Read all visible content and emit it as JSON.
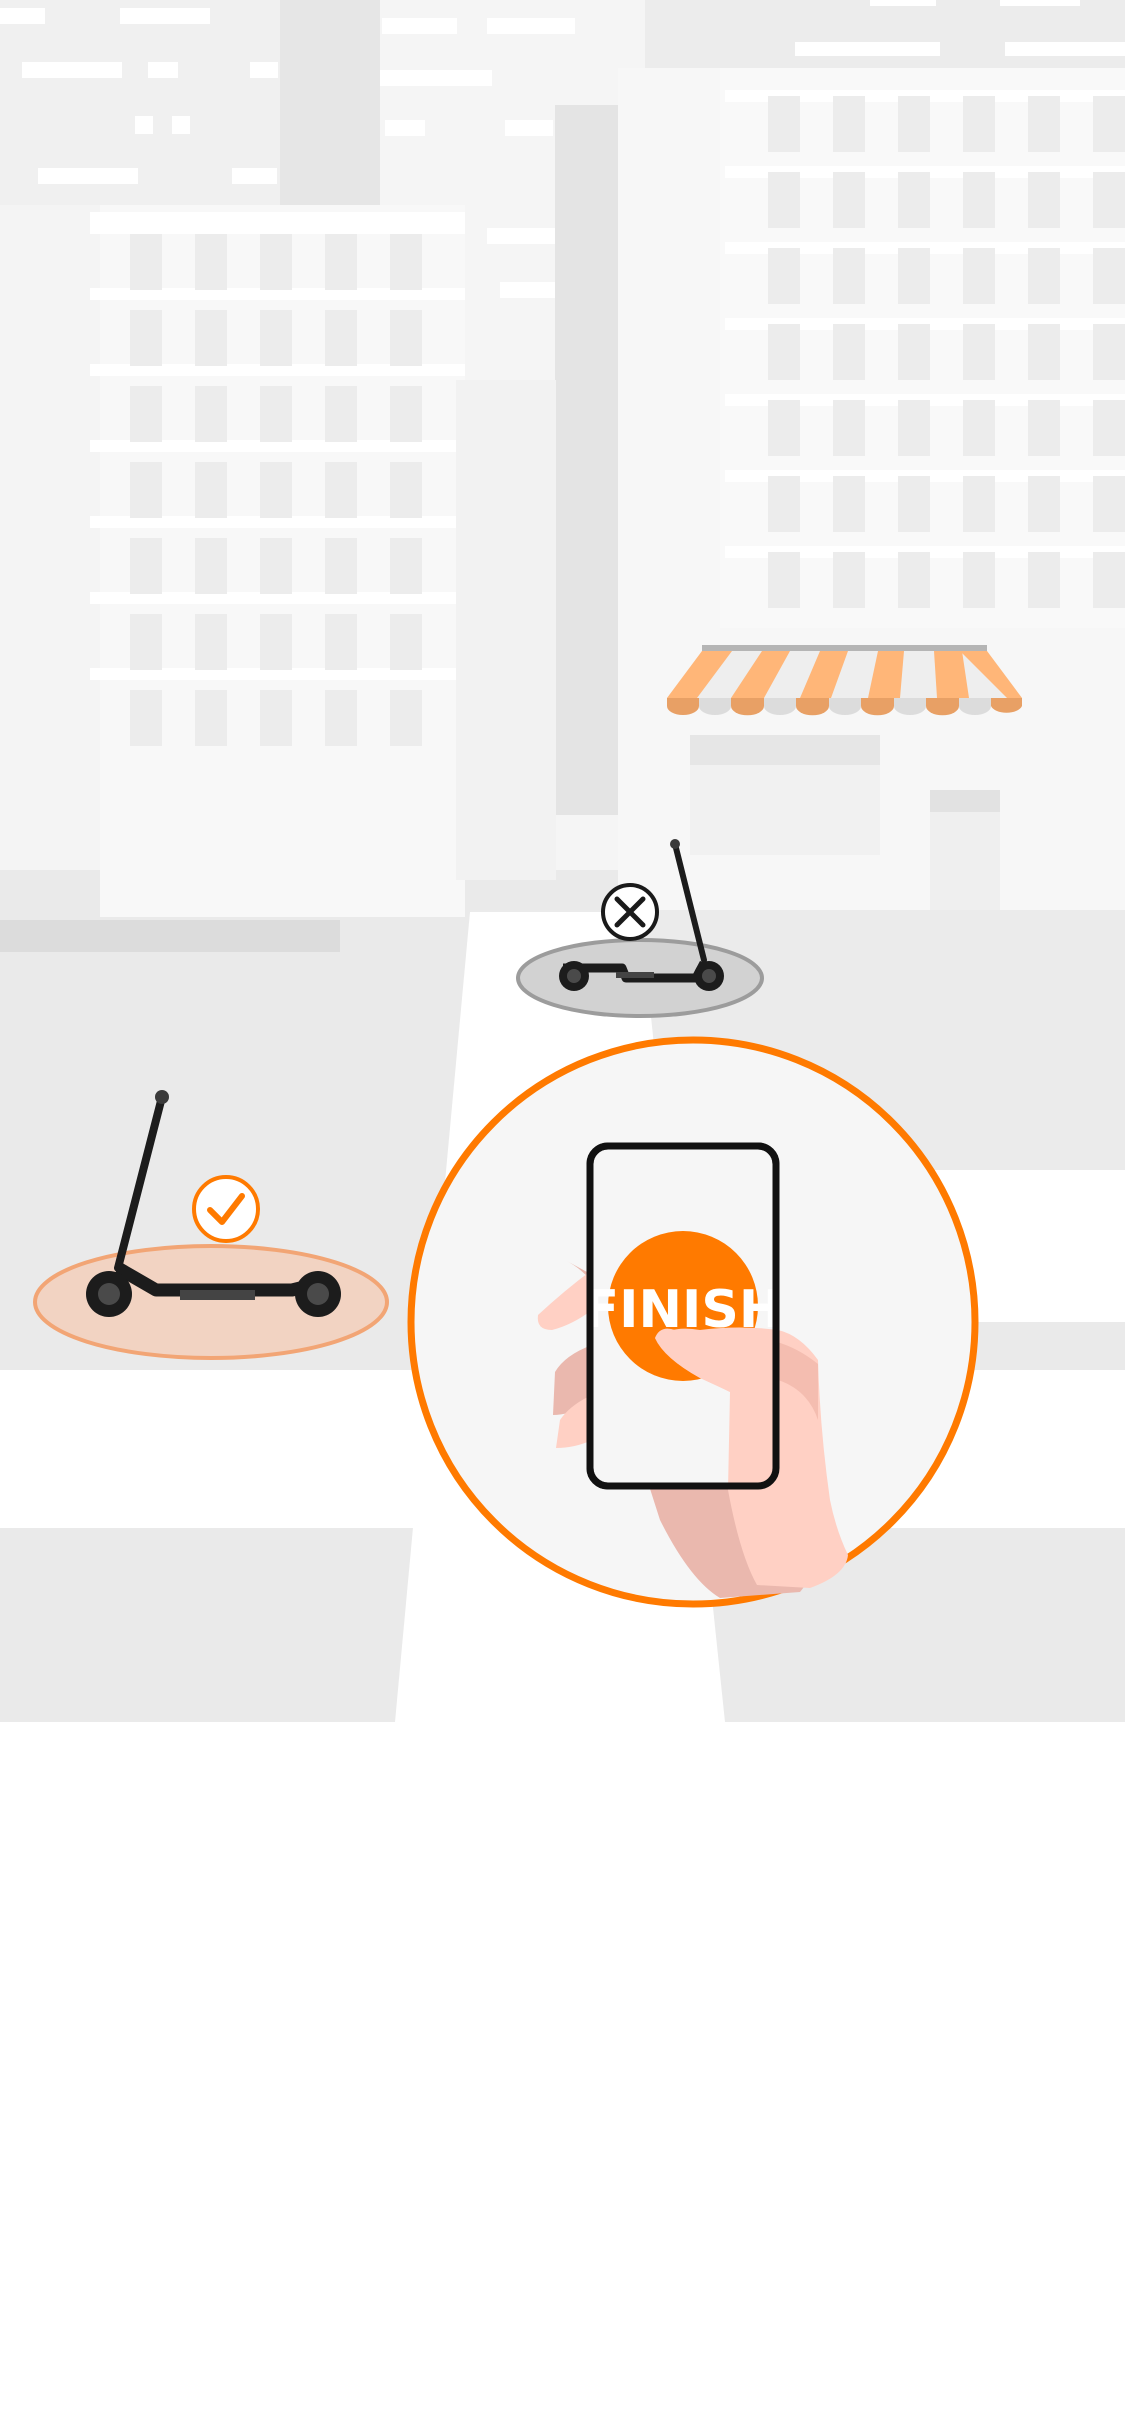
{
  "illustration": {
    "phone_button_label": "FINISH",
    "accent_color": "#FF7A00",
    "correct_parking_icon": "checkmark-circle-icon",
    "wrong_parking_icon": "x-circle-icon"
  }
}
